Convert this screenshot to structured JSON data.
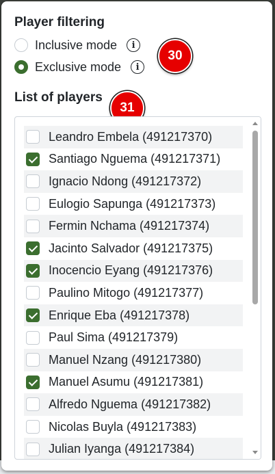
{
  "filtering": {
    "heading": "Player filtering",
    "modes": [
      {
        "label": "Inclusive mode",
        "selected": false,
        "info_icon": "info-circle-icon"
      },
      {
        "label": "Exclusive mode",
        "selected": true,
        "info_icon": "info-circle-icon"
      }
    ],
    "badge": "30"
  },
  "players": {
    "heading": "List of players",
    "badge": "31",
    "items": [
      {
        "label": "Leandro Embela (491217370)",
        "checked": false
      },
      {
        "label": "Santiago Nguema (491217371)",
        "checked": true
      },
      {
        "label": "Ignacio Ndong (491217372)",
        "checked": false
      },
      {
        "label": "Eulogio Sapunga (491217373)",
        "checked": false
      },
      {
        "label": "Fermin Nchama (491217374)",
        "checked": false
      },
      {
        "label": "Jacinto Salvador (491217375)",
        "checked": true
      },
      {
        "label": "Inocencio Eyang (491217376)",
        "checked": true
      },
      {
        "label": "Paulino Mitogo (491217377)",
        "checked": false
      },
      {
        "label": "Enrique Eba (491217378)",
        "checked": true
      },
      {
        "label": "Paul Sima (491217379)",
        "checked": false
      },
      {
        "label": "Manuel Nzang (491217380)",
        "checked": false
      },
      {
        "label": "Manuel Asumu (491217381)",
        "checked": true
      },
      {
        "label": "Alfredo Nguema (491217382)",
        "checked": false
      },
      {
        "label": "Nicolas Buyla (491217383)",
        "checked": false
      },
      {
        "label": "Julian Iyanga (491217384)",
        "checked": false
      }
    ]
  },
  "colors": {
    "accent": "#3b6e2f",
    "badge": "#e60000",
    "row_stripe": "#f2f3f4"
  }
}
